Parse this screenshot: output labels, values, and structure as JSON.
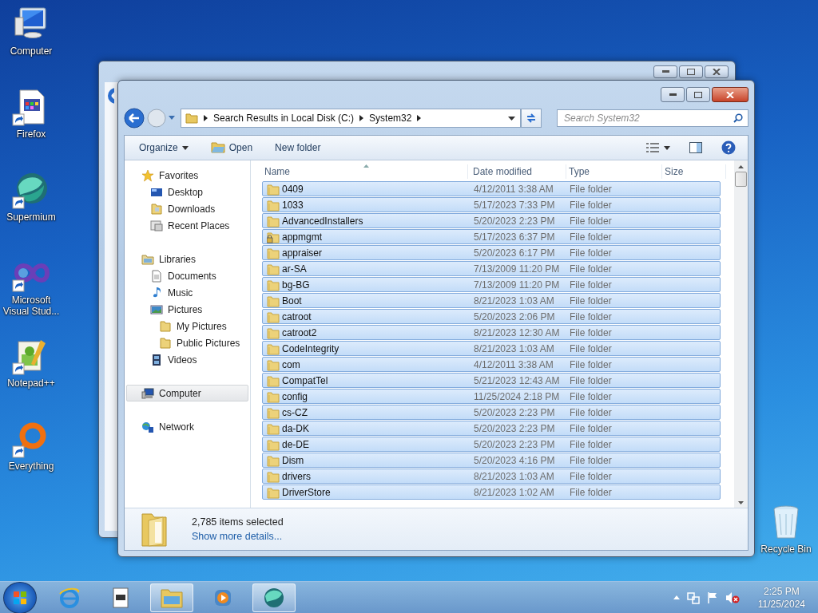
{
  "desktop_icons": [
    {
      "label": "Computer",
      "shortcut": false
    },
    {
      "label": "Firefox",
      "shortcut": true
    },
    {
      "label": "Supermium",
      "shortcut": true
    },
    {
      "label": "Microsoft Visual Stud...",
      "shortcut": true
    },
    {
      "label": "Notepad++",
      "shortcut": true
    },
    {
      "label": "Everything",
      "shortcut": true
    }
  ],
  "recycle_bin": {
    "label": "Recycle Bin"
  },
  "explorer": {
    "address": {
      "crumbs": [
        "Search Results in Local Disk (C:)",
        "System32"
      ]
    },
    "search": {
      "placeholder": "Search System32"
    },
    "toolbar": [
      {
        "label": "Organize",
        "kind": "menu"
      },
      {
        "label": "Open",
        "kind": "open"
      },
      {
        "label": "New folder",
        "kind": "plain"
      }
    ],
    "nav": [
      {
        "label": "Favorites",
        "selected": false,
        "children": [
          {
            "label": "Desktop",
            "selected": false
          },
          {
            "label": "Downloads",
            "selected": false
          },
          {
            "label": "Recent Places",
            "selected": false
          }
        ]
      },
      {
        "label": "Libraries",
        "selected": false,
        "children": [
          {
            "label": "Documents",
            "selected": false
          },
          {
            "label": "Music",
            "selected": false
          },
          {
            "label": "Pictures",
            "selected": false,
            "children": [
              {
                "label": "My Pictures",
                "selected": false
              },
              {
                "label": "Public Pictures",
                "selected": false
              }
            ]
          },
          {
            "label": "Videos",
            "selected": false
          }
        ]
      },
      {
        "label": "Computer",
        "selected": true
      },
      {
        "label": "Network",
        "selected": false
      }
    ],
    "columns": [
      {
        "label": "Name",
        "sorted": true
      },
      {
        "label": "Date modified",
        "sorted": false
      },
      {
        "label": "Type",
        "sorted": false
      },
      {
        "label": "Size",
        "sorted": false
      }
    ],
    "rows": [
      {
        "name": "0409",
        "date": "4/12/2011 3:38 AM",
        "type": "File folder",
        "locked": false,
        "selected": true
      },
      {
        "name": "1033",
        "date": "5/17/2023 7:33 PM",
        "type": "File folder",
        "locked": false,
        "selected": true
      },
      {
        "name": "AdvancedInstallers",
        "date": "5/20/2023 2:23 PM",
        "type": "File folder",
        "locked": false,
        "selected": true
      },
      {
        "name": "appmgmt",
        "date": "5/17/2023 6:37 PM",
        "type": "File folder",
        "locked": true,
        "selected": true
      },
      {
        "name": "appraiser",
        "date": "5/20/2023 6:17 PM",
        "type": "File folder",
        "locked": false,
        "selected": true
      },
      {
        "name": "ar-SA",
        "date": "7/13/2009 11:20 PM",
        "type": "File folder",
        "locked": false,
        "selected": true
      },
      {
        "name": "bg-BG",
        "date": "7/13/2009 11:20 PM",
        "type": "File folder",
        "locked": false,
        "selected": true
      },
      {
        "name": "Boot",
        "date": "8/21/2023 1:03 AM",
        "type": "File folder",
        "locked": false,
        "selected": true
      },
      {
        "name": "catroot",
        "date": "5/20/2023 2:06 PM",
        "type": "File folder",
        "locked": false,
        "selected": true
      },
      {
        "name": "catroot2",
        "date": "8/21/2023 12:30 AM",
        "type": "File folder",
        "locked": false,
        "selected": true
      },
      {
        "name": "CodeIntegrity",
        "date": "8/21/2023 1:03 AM",
        "type": "File folder",
        "locked": false,
        "selected": true
      },
      {
        "name": "com",
        "date": "4/12/2011 3:38 AM",
        "type": "File folder",
        "locked": false,
        "selected": true
      },
      {
        "name": "CompatTel",
        "date": "5/21/2023 12:43 AM",
        "type": "File folder",
        "locked": false,
        "selected": true
      },
      {
        "name": "config",
        "date": "11/25/2024 2:18 PM",
        "type": "File folder",
        "locked": false,
        "selected": true
      },
      {
        "name": "cs-CZ",
        "date": "5/20/2023 2:23 PM",
        "type": "File folder",
        "locked": false,
        "selected": true
      },
      {
        "name": "da-DK",
        "date": "5/20/2023 2:23 PM",
        "type": "File folder",
        "locked": false,
        "selected": true
      },
      {
        "name": "de-DE",
        "date": "5/20/2023 2:23 PM",
        "type": "File folder",
        "locked": false,
        "selected": true
      },
      {
        "name": "Dism",
        "date": "5/20/2023 4:16 PM",
        "type": "File folder",
        "locked": false,
        "selected": true
      },
      {
        "name": "drivers",
        "date": "8/21/2023 1:03 AM",
        "type": "File folder",
        "locked": false,
        "selected": true
      },
      {
        "name": "DriverStore",
        "date": "8/21/2023 1:02 AM",
        "type": "File folder",
        "locked": false,
        "selected": true
      }
    ],
    "details": {
      "summary": "2,785 items selected",
      "link": "Show more details..."
    }
  },
  "taskbar": {
    "items": [
      {
        "open": false
      },
      {
        "open": false
      },
      {
        "open": true
      },
      {
        "open": false
      },
      {
        "open": true
      }
    ],
    "time": "2:25 PM",
    "date": "11/25/2024"
  }
}
